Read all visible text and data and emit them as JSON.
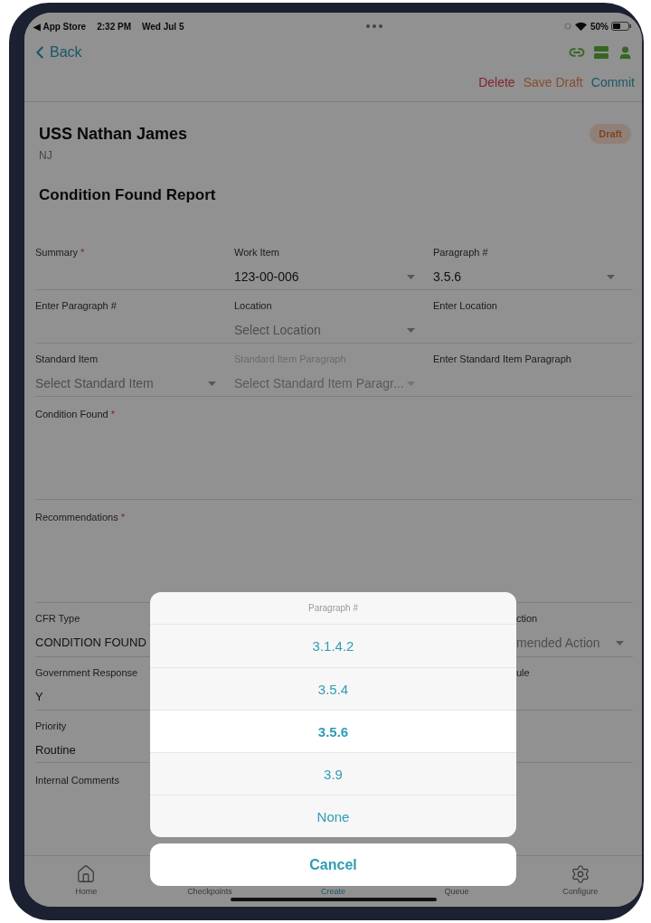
{
  "status_bar": {
    "back_app": "◀ App Store",
    "time": "2:32 PM",
    "date": "Wed Jul 5",
    "battery": "50%"
  },
  "nav": {
    "back": "Back"
  },
  "actions": [
    {
      "label": "Delete",
      "kind": "danger"
    },
    {
      "label": "Save Draft",
      "kind": "warning"
    },
    {
      "label": "Commit",
      "kind": "primary"
    }
  ],
  "header": {
    "title": "USS Nathan James",
    "subtitle": "NJ",
    "badge": "Draft"
  },
  "form": {
    "title": "Condition Found Report",
    "rows": [
      [
        {
          "kind": "text",
          "label": "Summary",
          "mark": "*"
        },
        {
          "kind": "dropdown",
          "label": "Work Item",
          "value": "123-00-006",
          "disabled": false
        },
        {
          "kind": "dropdown",
          "label": "Paragraph #",
          "value": "3.5.6",
          "disabled": false
        }
      ],
      [
        {
          "kind": "text",
          "label": "Enter Paragraph #"
        },
        {
          "kind": "dropdown",
          "label": "Location",
          "placeholder": "Select Location",
          "disabled": false
        },
        {
          "kind": "text",
          "label": "Enter Location"
        }
      ],
      [
        {
          "kind": "dropdown",
          "label": "Standard Item",
          "placeholder": "Select Standard Item",
          "disabled": false
        },
        {
          "kind": "dropdown",
          "label": "Standard Item Paragraph",
          "placeholder": "Select Standard Item Paragr...",
          "disabled": true
        },
        {
          "kind": "text",
          "label": "Enter Standard Item Paragraph"
        }
      ]
    ],
    "text_areas": [
      {
        "label": "Condition Found",
        "mark": "*"
      },
      {
        "label": "Recommendations",
        "mark": "*"
      }
    ],
    "partial_rows": [
      {
        "left": {
          "label": "CFR Type",
          "value": "CONDITION FOUND"
        },
        "right": {
          "label": "ction",
          "placeholder": "mended Action",
          "kind": "dropdown"
        }
      },
      {
        "left": {
          "label": "Government Response",
          "value": "Y"
        },
        "right": {
          "label": "ule",
          "kind": "text"
        }
      },
      {
        "left": {
          "label": "Priority",
          "value": "Routine"
        }
      },
      {
        "left": {
          "label": "Internal Comments"
        }
      }
    ]
  },
  "tab_bar": [
    {
      "label": "Home",
      "kind": "home",
      "selected": false
    },
    {
      "label": "Checkpoints",
      "selected": false
    },
    {
      "label": "Create",
      "selected": true
    },
    {
      "label": "Queue",
      "selected": false
    },
    {
      "label": "Configure",
      "kind": "gear",
      "selected": false
    }
  ],
  "picker": {
    "title": "Paragraph #",
    "options": [
      {
        "label": "3.1.4.2",
        "selected": false
      },
      {
        "label": "3.5.4",
        "selected": false
      },
      {
        "label": "3.5.6",
        "selected": true
      },
      {
        "label": "3.9",
        "selected": false
      },
      {
        "label": "None",
        "selected": false
      }
    ],
    "cancel": "Cancel"
  }
}
